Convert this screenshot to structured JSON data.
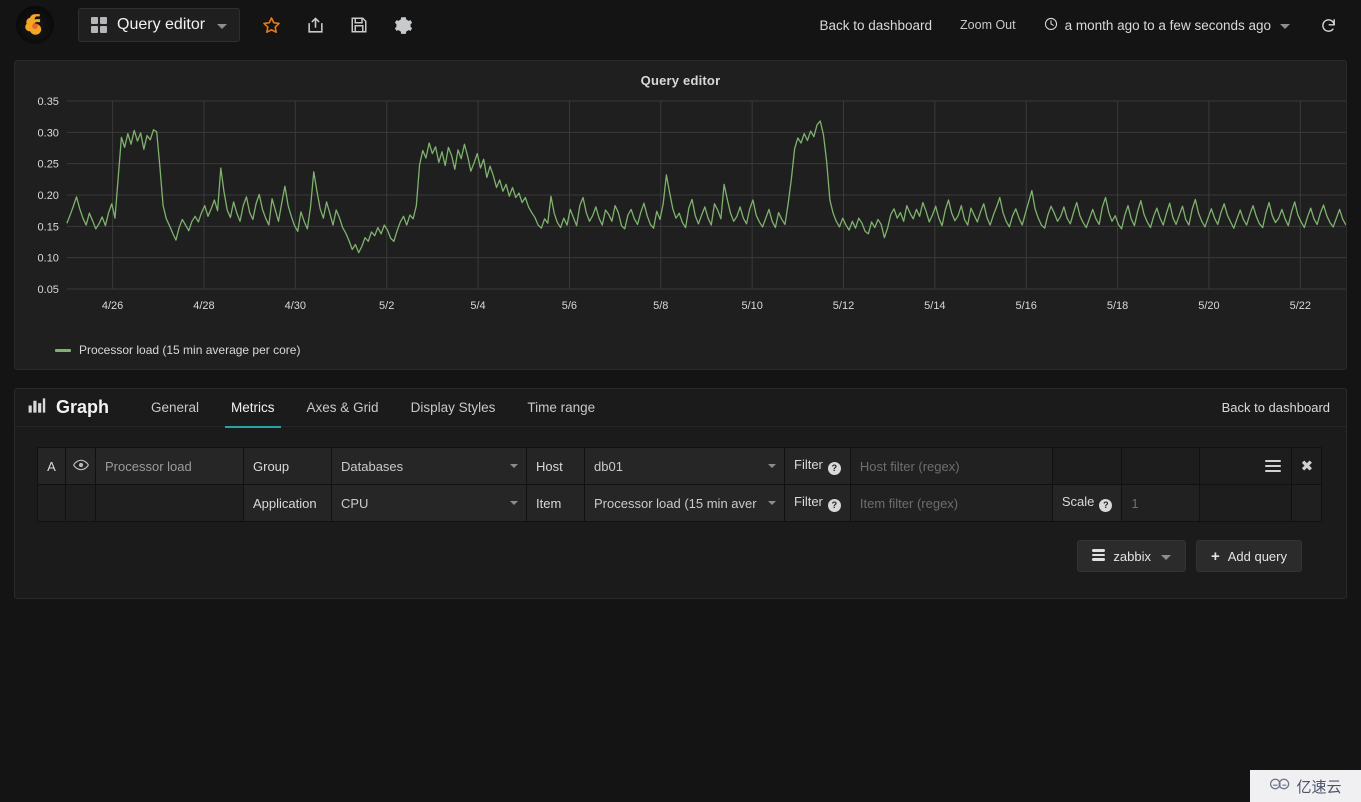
{
  "topnav": {
    "logo_icon": "grafana-logo-icon",
    "dashboard_picker": {
      "icon": "grid-icon",
      "title": "Query editor",
      "caret": "chevron-down-icon"
    },
    "actions": [
      {
        "name": "star-icon",
        "label": "star"
      },
      {
        "name": "share-icon",
        "label": "share"
      },
      {
        "name": "save-icon",
        "label": "save"
      },
      {
        "name": "gear-icon",
        "label": "settings"
      }
    ],
    "back_to_dashboard": "Back to dashboard",
    "zoom_out": "Zoom Out",
    "time_range": "a month ago to a few seconds ago",
    "time_icon": "clock-icon",
    "refresh_icon": "refresh-icon"
  },
  "panel": {
    "title": "Query editor",
    "legend": {
      "label": "Processor load (15 min average per core)",
      "color": "#7eb26d"
    }
  },
  "chart_data": {
    "type": "line",
    "title": "Query editor",
    "xlabel": "",
    "ylabel": "",
    "grid": true,
    "legend_position": "bottom-left",
    "series_color": "#7eb26d",
    "ylim": [
      0.05,
      0.35
    ],
    "ytick_labels": [
      "0.35",
      "0.30",
      "0.25",
      "0.20",
      "0.15",
      "0.10",
      "0.05"
    ],
    "ytick_values": [
      0.35,
      0.3,
      0.25,
      0.2,
      0.15,
      0.1,
      0.05
    ],
    "xtick_labels": [
      "4/26",
      "4/28",
      "4/30",
      "5/2",
      "5/4",
      "5/6",
      "5/8",
      "5/10",
      "5/12",
      "5/14",
      "5/16",
      "5/18",
      "5/20",
      "5/22"
    ],
    "series": [
      {
        "name": "Processor load (15 min average per core)",
        "values": [
          0.155,
          0.168,
          0.182,
          0.197,
          0.178,
          0.163,
          0.152,
          0.171,
          0.159,
          0.146,
          0.154,
          0.165,
          0.151,
          0.172,
          0.186,
          0.163,
          0.228,
          0.292,
          0.276,
          0.298,
          0.281,
          0.303,
          0.286,
          0.299,
          0.273,
          0.295,
          0.288,
          0.304,
          0.301,
          0.245,
          0.183,
          0.162,
          0.151,
          0.139,
          0.128,
          0.148,
          0.161,
          0.152,
          0.143,
          0.158,
          0.166,
          0.157,
          0.172,
          0.183,
          0.166,
          0.178,
          0.192,
          0.175,
          0.243,
          0.205,
          0.176,
          0.164,
          0.189,
          0.171,
          0.158,
          0.183,
          0.197,
          0.172,
          0.161,
          0.186,
          0.201,
          0.177,
          0.163,
          0.152,
          0.194,
          0.176,
          0.158,
          0.187,
          0.214,
          0.183,
          0.166,
          0.151,
          0.142,
          0.173,
          0.158,
          0.146,
          0.181,
          0.237,
          0.206,
          0.178,
          0.163,
          0.189,
          0.171,
          0.152,
          0.176,
          0.164,
          0.148,
          0.139,
          0.127,
          0.113,
          0.121,
          0.108,
          0.118,
          0.132,
          0.126,
          0.141,
          0.135,
          0.148,
          0.138,
          0.152,
          0.144,
          0.131,
          0.126,
          0.143,
          0.157,
          0.166,
          0.152,
          0.168,
          0.162,
          0.183,
          0.248,
          0.271,
          0.259,
          0.283,
          0.266,
          0.277,
          0.252,
          0.269,
          0.247,
          0.276,
          0.263,
          0.241,
          0.272,
          0.258,
          0.281,
          0.262,
          0.238,
          0.251,
          0.266,
          0.243,
          0.257,
          0.228,
          0.246,
          0.231,
          0.212,
          0.224,
          0.206,
          0.217,
          0.198,
          0.212,
          0.196,
          0.203,
          0.188,
          0.196,
          0.181,
          0.172,
          0.164,
          0.152,
          0.147,
          0.162,
          0.155,
          0.198,
          0.171,
          0.156,
          0.148,
          0.163,
          0.152,
          0.177,
          0.164,
          0.151,
          0.183,
          0.196,
          0.172,
          0.158,
          0.167,
          0.181,
          0.163,
          0.152,
          0.176,
          0.169,
          0.158,
          0.183,
          0.172,
          0.151,
          0.146,
          0.168,
          0.177,
          0.162,
          0.153,
          0.172,
          0.187,
          0.167,
          0.153,
          0.147,
          0.174,
          0.161,
          0.186,
          0.232,
          0.204,
          0.178,
          0.163,
          0.171,
          0.156,
          0.148,
          0.179,
          0.193,
          0.167,
          0.154,
          0.168,
          0.181,
          0.163,
          0.152,
          0.186,
          0.176,
          0.162,
          0.217,
          0.193,
          0.171,
          0.158,
          0.166,
          0.181,
          0.163,
          0.154,
          0.178,
          0.192,
          0.168,
          0.157,
          0.149,
          0.163,
          0.177,
          0.158,
          0.148,
          0.172,
          0.161,
          0.153,
          0.187,
          0.226,
          0.274,
          0.291,
          0.283,
          0.298,
          0.287,
          0.302,
          0.293,
          0.312,
          0.318,
          0.296,
          0.253,
          0.192,
          0.171,
          0.158,
          0.149,
          0.163,
          0.152,
          0.144,
          0.158,
          0.147,
          0.163,
          0.155,
          0.142,
          0.138,
          0.157,
          0.148,
          0.161,
          0.153,
          0.132,
          0.147,
          0.169,
          0.178,
          0.163,
          0.172,
          0.158,
          0.183,
          0.171,
          0.162,
          0.177,
          0.166,
          0.188,
          0.174,
          0.157,
          0.168,
          0.182,
          0.163,
          0.151,
          0.176,
          0.192,
          0.171,
          0.159,
          0.167,
          0.183,
          0.161,
          0.152,
          0.179,
          0.168,
          0.157,
          0.173,
          0.186,
          0.164,
          0.152,
          0.168,
          0.181,
          0.196,
          0.172,
          0.158,
          0.149,
          0.167,
          0.178,
          0.163,
          0.152,
          0.171,
          0.189,
          0.207,
          0.178,
          0.163,
          0.152,
          0.147,
          0.168,
          0.182,
          0.171,
          0.158,
          0.166,
          0.181,
          0.163,
          0.154,
          0.172,
          0.188,
          0.167,
          0.156,
          0.148,
          0.163,
          0.177,
          0.162,
          0.153,
          0.181,
          0.196,
          0.172,
          0.158,
          0.167,
          0.153,
          0.146,
          0.168,
          0.183,
          0.162,
          0.151,
          0.174,
          0.191,
          0.169,
          0.157,
          0.148,
          0.166,
          0.179,
          0.163,
          0.152,
          0.171,
          0.187,
          0.164,
          0.153,
          0.168,
          0.182,
          0.161,
          0.152,
          0.177,
          0.193,
          0.171,
          0.158,
          0.149,
          0.164,
          0.178,
          0.163,
          0.153,
          0.172,
          0.186,
          0.168,
          0.157,
          0.147,
          0.162,
          0.176,
          0.161,
          0.152,
          0.169,
          0.183,
          0.166,
          0.154,
          0.148,
          0.171,
          0.188,
          0.167,
          0.156,
          0.163,
          0.177,
          0.162,
          0.151,
          0.173,
          0.189,
          0.168,
          0.157,
          0.148,
          0.165,
          0.179,
          0.162,
          0.153,
          0.171,
          0.184,
          0.167,
          0.156,
          0.149,
          0.163,
          0.177,
          0.161,
          0.152
        ]
      }
    ]
  },
  "editor": {
    "brand_icon": "bar-chart-icon",
    "brand_label": "Graph",
    "tabs": [
      {
        "label": "General",
        "active": false
      },
      {
        "label": "Metrics",
        "active": true
      },
      {
        "label": "Axes & Grid",
        "active": false
      },
      {
        "label": "Display Styles",
        "active": false
      },
      {
        "label": "Time range",
        "active": false
      }
    ],
    "back_to_dashboard": "Back to dashboard",
    "query": {
      "ref_id": "A",
      "eye_icon": "eye-icon",
      "alias": "Processor load",
      "group_label": "Group",
      "group_value": "Databases",
      "host_label": "Host",
      "host_value": "db01",
      "filter_label": "Filter",
      "host_filter_placeholder": "Host filter (regex)",
      "host_filter_value": "",
      "application_label": "Application",
      "application_value": "CPU",
      "item_label": "Item",
      "item_value": "Processor load (15 min aver",
      "item_filter_placeholder": "Item filter (regex)",
      "item_filter_value": "",
      "scale_label": "Scale",
      "scale_placeholder": "1",
      "scale_value": "",
      "menu_icon": "hamburger-icon",
      "remove_icon": "close-icon"
    },
    "datasource_button": {
      "icon": "database-icon",
      "label": "zabbix",
      "caret": "chevron-down-icon"
    },
    "add_query_button": {
      "plus": "+",
      "label": "Add query"
    }
  },
  "watermark": {
    "icon": "cloud-icon",
    "label": "亿速云"
  }
}
